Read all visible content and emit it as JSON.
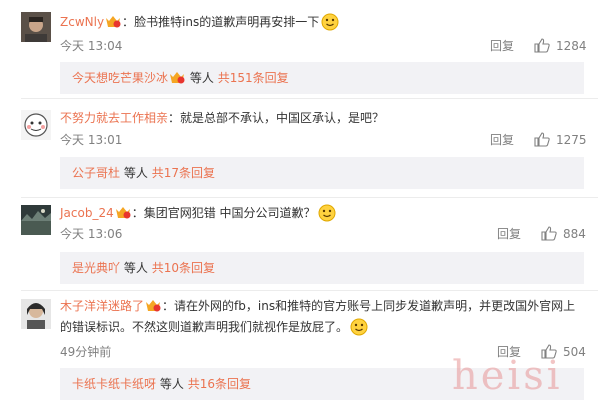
{
  "comments": [
    {
      "user": "ZcwNly",
      "separator": "：",
      "text": "脸书推特ins的道歉声明再安排一下",
      "time": "今天 13:04",
      "reply_label": "回复",
      "likes": "1284",
      "sub_users": "今天想吃芒果沙冰",
      "sub_text": "等人",
      "sub_count": "共151条回复"
    },
    {
      "user": "不努力就去工作相亲",
      "separator": "：",
      "text": "就是总部不承认，中国区承认，是吧？",
      "time": "今天 13:01",
      "reply_label": "回复",
      "likes": "1275",
      "sub_users": "公子哥杜",
      "sub_text": "等人",
      "sub_count": "共17条回复"
    },
    {
      "user": "Jacob_24",
      "separator": "：",
      "text": "集团官网犯错   中国分公司道歉？",
      "time": "今天 13:06",
      "reply_label": "回复",
      "likes": "884",
      "sub_users": "是光典吖",
      "sub_text": "等人",
      "sub_count": "共10条回复"
    },
    {
      "user": "木子洋洋迷路了",
      "separator": "：",
      "text": "请在外网的fb，ins和推特的官方账号上同步发道歉声明，并更改国外官网上的错误标识。不然这则道歉声明我们就视作是放屁了。",
      "time": "49分钟前",
      "reply_label": "回复",
      "likes": "504",
      "sub_users": "卡纸卡纸卡纸呀",
      "sub_text": "等人",
      "sub_count": "共16条回复"
    }
  ],
  "watermark": "heisi",
  "colors": {
    "link": "#eb7350",
    "meta": "#808080",
    "subbox": "#f2f2f5"
  },
  "icons": {
    "badge": "vip-badge-icon",
    "like": "thumb-up-icon",
    "emoji": "smile-emoji-icon"
  }
}
